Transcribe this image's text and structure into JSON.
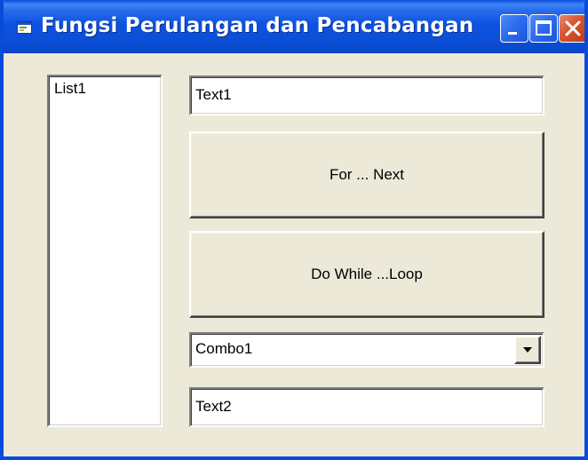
{
  "window": {
    "title": "Fungsi Perulangan dan Pencabangan",
    "title_icon": "vb-form-icon",
    "controls": [
      "minimize",
      "maximize",
      "close"
    ]
  },
  "listbox": {
    "label": "List1"
  },
  "text1": {
    "value": "Text1"
  },
  "for_next_button": {
    "label": "For ... Next"
  },
  "do_while_button": {
    "label": "Do While ...Loop"
  },
  "combo1": {
    "value": "Combo1"
  },
  "text2": {
    "value": "Text2"
  },
  "colors": {
    "titlebar": "#0a4fd8",
    "face": "#ece9d8",
    "close": "#d9532e"
  }
}
